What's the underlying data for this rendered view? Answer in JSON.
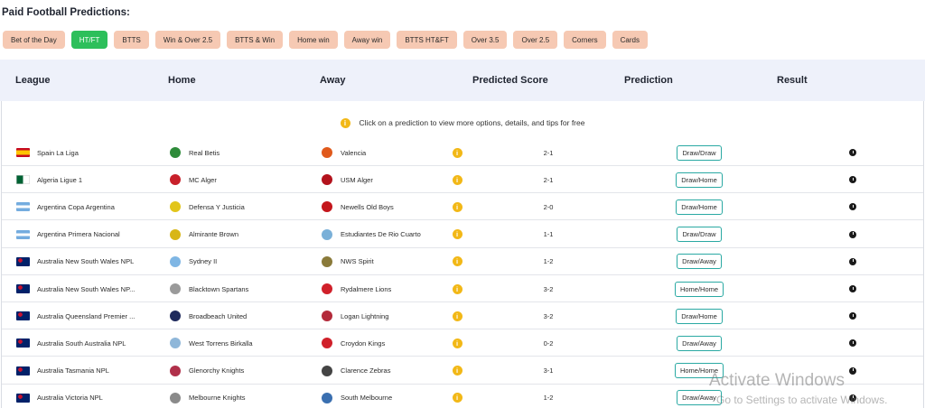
{
  "page_title": "Paid Football Predictions:",
  "filters": [
    {
      "label": "Bet of the Day",
      "active": false
    },
    {
      "label": "HT/FT",
      "active": true
    },
    {
      "label": "BTTS",
      "active": false
    },
    {
      "label": "Win & Over 2.5",
      "active": false
    },
    {
      "label": "BTTS & Win",
      "active": false
    },
    {
      "label": "Home win",
      "active": false
    },
    {
      "label": "Away win",
      "active": false
    },
    {
      "label": "BTTS HT&FT",
      "active": false
    },
    {
      "label": "Over 3.5",
      "active": false
    },
    {
      "label": "Over 2.5",
      "active": false
    },
    {
      "label": "Corners",
      "active": false
    },
    {
      "label": "Cards",
      "active": false
    }
  ],
  "columns": {
    "league": "League",
    "home": "Home",
    "away": "Away",
    "score": "Predicted Score",
    "prediction": "Prediction",
    "result": "Result"
  },
  "info_text": "Click on a prediction to view more options, details, and tips for free",
  "info_icon": "i",
  "rows": [
    {
      "league": "Spain La Liga",
      "home": "Real Betis",
      "away": "Valencia",
      "score": "2-1",
      "prediction": "Draw/Draw",
      "flag": "spain",
      "home_color": "#2e8b3a",
      "away_color": "#e05a1c"
    },
    {
      "league": "Algeria Ligue 1",
      "home": "MC Alger",
      "away": "USM Alger",
      "score": "2-1",
      "prediction": "Draw/Home",
      "flag": "algeria",
      "home_color": "#c8202a",
      "away_color": "#b3121c"
    },
    {
      "league": "Argentina Copa Argentina",
      "home": "Defensa Y Justicia",
      "away": "Newells Old Boys",
      "score": "2-0",
      "prediction": "Draw/Home",
      "flag": "argentina",
      "home_color": "#e2c51b",
      "away_color": "#c4161c"
    },
    {
      "league": "Argentina Primera Nacional",
      "home": "Almirante Brown",
      "away": "Estudiantes De Rio Cuarto",
      "score": "1-1",
      "prediction": "Draw/Draw",
      "flag": "argentina",
      "home_color": "#d8b616",
      "away_color": "#7ab0d8"
    },
    {
      "league": "Australia New South Wales NPL",
      "home": "Sydney II",
      "away": "NWS Spirit",
      "score": "1-2",
      "prediction": "Draw/Away",
      "flag": "australia",
      "home_color": "#7fb6e4",
      "away_color": "#8a7a3a"
    },
    {
      "league": "Australia New South Wales NP...",
      "home": "Blacktown Spartans",
      "away": "Rydalmere Lions",
      "score": "3-2",
      "prediction": "Home/Home",
      "flag": "australia",
      "home_color": "#9a9a9a",
      "away_color": "#d0202a"
    },
    {
      "league": "Australia Queensland Premier ...",
      "home": "Broadbeach United",
      "away": "Logan Lightning",
      "score": "3-2",
      "prediction": "Draw/Home",
      "flag": "australia",
      "home_color": "#1f2a5c",
      "away_color": "#b32a3a"
    },
    {
      "league": "Australia South Australia NPL",
      "home": "West Torrens Birkalla",
      "away": "Croydon Kings",
      "score": "0-2",
      "prediction": "Draw/Away",
      "flag": "australia",
      "home_color": "#8fb7d9",
      "away_color": "#d0202a"
    },
    {
      "league": "Australia Tasmania NPL",
      "home": "Glenorchy Knights",
      "away": "Clarence Zebras",
      "score": "3-1",
      "prediction": "Home/Home",
      "flag": "australia",
      "home_color": "#b0304a",
      "away_color": "#444444"
    },
    {
      "league": "Australia Victoria NPL",
      "home": "Melbourne Knights",
      "away": "South Melbourne",
      "score": "1-2",
      "prediction": "Draw/Away",
      "flag": "australia",
      "home_color": "#8a8a8a",
      "away_color": "#3a6fb0"
    }
  ],
  "watermark": {
    "line1": "Activate Windows",
    "line2": "Go to Settings to activate Windows."
  }
}
